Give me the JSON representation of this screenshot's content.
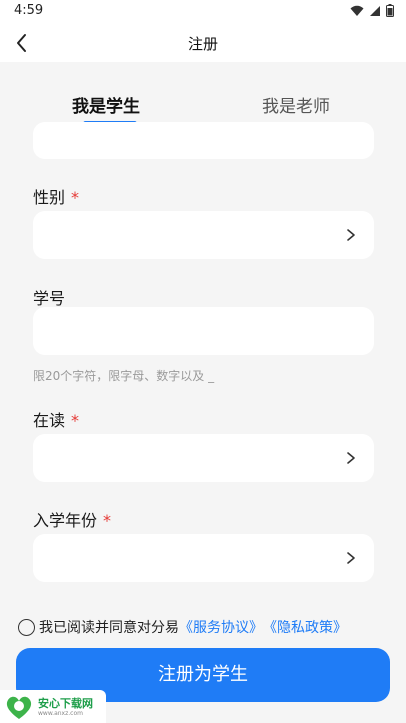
{
  "status_bar": {
    "time": "4:59"
  },
  "nav": {
    "title": "注册"
  },
  "tabs": [
    {
      "label": "我是学生",
      "active": true
    },
    {
      "label": "我是老师",
      "active": false
    }
  ],
  "form": {
    "gender": {
      "label": "性别",
      "required_mark": "*"
    },
    "student_id": {
      "label": "学号",
      "hint": "限20个字符，限字母、数字以及 _"
    },
    "enrollment": {
      "label": "在读",
      "required_mark": "*"
    },
    "entry_year": {
      "label": "入学年份",
      "required_mark": "*"
    }
  },
  "agreement": {
    "prefix": "我已阅读并同意对分易",
    "service_link": "《服务协议》",
    "privacy_link": "《隐私政策》"
  },
  "submit": {
    "label": "注册为学生"
  },
  "watermark": {
    "name": "安心下载网",
    "url": "www.anxz.com"
  },
  "colors": {
    "accent": "#1f7cf6",
    "required": "#e53935",
    "background": "#f5f5f5"
  },
  "icons": [
    "back-arrow-icon",
    "chevron-right-icon",
    "wifi-icon",
    "signal-icon",
    "battery-icon"
  ]
}
